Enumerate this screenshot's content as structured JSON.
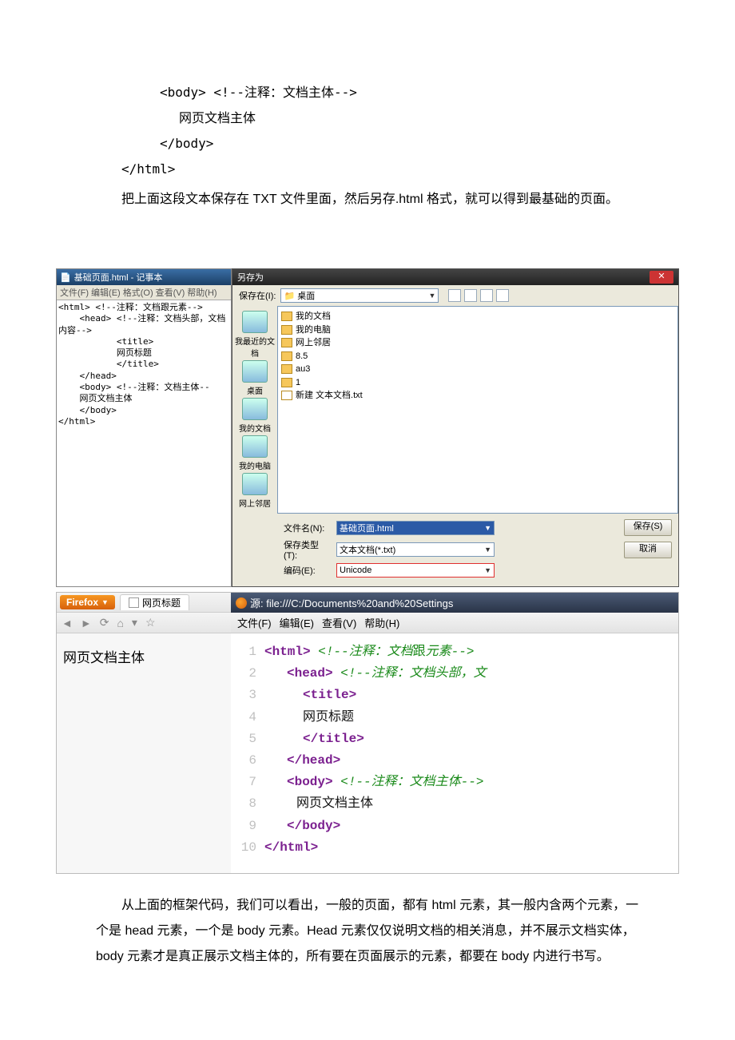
{
  "code": {
    "l1": "<body> <!--注释：文档主体-->",
    "l2": "网页文档主体",
    "l3": "</body>",
    "l4": "</html>"
  },
  "para1": "把上面这段文本保存在 TXT 文件里面，然后另存.html 格式，就可以得到最基础的页面。",
  "notepad": {
    "title": "基础页面.html - 记事本",
    "menu": {
      "file": "文件(F)",
      "edit": "编辑(E)",
      "format": "格式(O)",
      "view": "查看(V)",
      "help": "帮助(H)"
    },
    "body": "<html> <!--注释：文档跟元素-->\n    <head> <!--注释：文档头部，文档\n内容-->\n           <title>\n           网页标题\n           </title>\n    </head>\n    <body> <!--注释：文档主体--\n    网页文档主体\n    </body>\n</html>"
  },
  "save": {
    "title": "另存为",
    "save_in": "保存在(I):",
    "folder": "桌面",
    "side": [
      "我最近的文档",
      "桌面",
      "我的文档",
      "我的电脑",
      "网上邻居"
    ],
    "list": [
      "我的文档",
      "我的电脑",
      "网上邻居",
      "8.5",
      "au3",
      "1",
      "新建 文本文档.txt"
    ],
    "filename_label": "文件名(N):",
    "filename_value": "基础页面.html",
    "type_label": "保存类型(T):",
    "type_value": "文本文档(*.txt)",
    "encoding_label": "编码(E):",
    "encoding_value": "Unicode",
    "btn_save": "保存(S)",
    "btn_cancel": "取消"
  },
  "browser": {
    "ff_label": "Firefox",
    "tab": "网页标题",
    "body_text": "网页文档主体",
    "src_title": "源: file:///C:/Documents%20and%20Settings",
    "menu": {
      "file": "文件(F)",
      "edit": "编辑(E)",
      "view": "查看(V)",
      "help": "帮助(H)"
    },
    "src": [
      {
        "n": "1",
        "raw": "<b class='tag'>&lt;html&gt;</b>  <span class='cmt'>&lt;!--注释：文档<span style='font-style:normal'>跟</span>元素--&gt;</span>"
      },
      {
        "n": "2",
        "raw": "<span class='ind-a'></span><b class='tag'>&lt;head&gt;</b>  <span class='cmt'>&lt;!--注释：文档头部，文</span>"
      },
      {
        "n": "3",
        "raw": "<span class='ind-b'></span><span class='tag'>&lt;title&gt;</span>"
      },
      {
        "n": "4",
        "raw": "<span class='ind-b'></span><span class='txt'>网页标题</span>"
      },
      {
        "n": "5",
        "raw": "<span class='ind-b'></span><span class='tag'>&lt;/title&gt;</span>"
      },
      {
        "n": "6",
        "raw": "<span class='ind-a'></span><span class='tag'>&lt;/head&gt;</span>"
      },
      {
        "n": "7",
        "raw": "<span class='ind-a'></span><b class='tag'>&lt;body&gt;</b>  <span class='cmt'>&lt;!--注释：文档主体--&gt;</span>"
      },
      {
        "n": "8",
        "raw": "<span class='ind-c'></span><span class='txt'>网页文档主体</span>"
      },
      {
        "n": "9",
        "raw": "<span class='ind-a'></span><b class='tag'>&lt;/body&gt;</b>"
      },
      {
        "n": "10",
        "raw": "<b class='tag'>&lt;/html&gt;</b>"
      }
    ]
  },
  "para2": "从上面的框架代码，我们可以看出，一般的页面，都有 html 元素，其一般内含两个元素，一个是 head 元素，一个是 body 元素。Head 元素仅仅说明文档的相关消息，并不展示文档实体，body 元素才是真正展示文档主体的，所有要在页面展示的元素，都要在 body 内进行书写。"
}
